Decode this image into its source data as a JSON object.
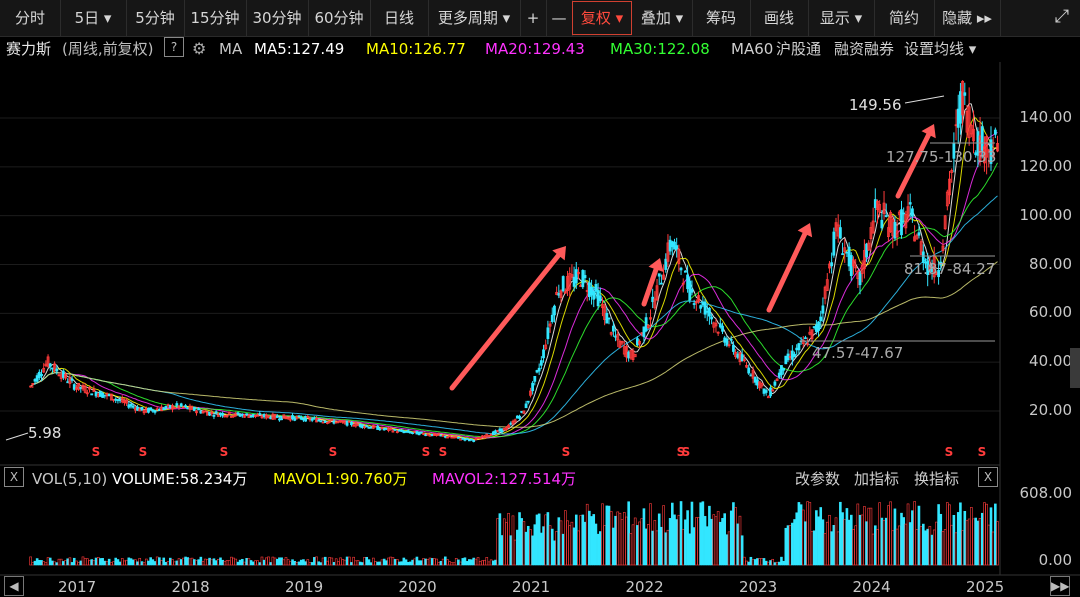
{
  "toolbar": {
    "items": [
      "分时",
      "5日 ▾",
      "5分钟",
      "15分钟",
      "30分钟",
      "60分钟",
      "日线",
      "更多周期 ▾",
      "+",
      "—",
      "复权 ▾",
      "叠加 ▾",
      "筹码",
      "画线",
      "显示 ▾",
      "简约",
      "隐藏 ▸▸"
    ],
    "active_index": 10,
    "expand_icon": "expand-icon"
  },
  "info": {
    "stock_name": "赛力斯",
    "period_note": "(周线,前复权)",
    "help": "?",
    "gear_icon": "gear-icon",
    "ma_label": "MA",
    "ma5": "MA5:127.49",
    "ma10": "MA10:126.77",
    "ma20": "MA20:129.43",
    "ma30": "MA30:122.08",
    "ma60": "MA60",
    "hsgt": "沪股通",
    "margin": "融资融券",
    "settings": "设置均线 ▾"
  },
  "vol": {
    "close_box": "X",
    "label": "VOL(5,10)",
    "volume": "VOLUME:58.234万",
    "mavol1": "MAVOL1:90.760万",
    "mavol2": "MAVOL2:127.514万",
    "change_params": "改参数",
    "add_indicator": "加指标",
    "switch_indicator": "换指标",
    "close_box2": "X"
  },
  "colors": {
    "up": "#ff3b3b",
    "down": "#33e6ff",
    "ma5": "#ffffff",
    "ma10": "#ffff00",
    "ma20": "#ff33ff",
    "ma30": "#33ff33",
    "ma60": "#33ccff",
    "arrow": "#ff5a5a",
    "annotation": "#c8c8c8"
  },
  "chart_data": {
    "type": "candlestick",
    "period": "weekly",
    "y_ticks": [
      "140.00",
      "120.00",
      "100.00",
      "80.00",
      "60.00",
      "40.00",
      "20.00"
    ],
    "ylim": [
      5,
      150
    ],
    "x_ticks": [
      "2017",
      "2018",
      "2019",
      "2020",
      "2021",
      "2022",
      "2023",
      "2024",
      "2025"
    ],
    "annotations": {
      "high": "149.56",
      "low": "5.98",
      "range1": "127.75-130.33",
      "range2": "81.87-84.27",
      "range3": "47.57-47.67"
    },
    "price_keypoints": [
      [
        2016.6,
        30
      ],
      [
        2016.75,
        40
      ],
      [
        2017.0,
        30
      ],
      [
        2017.3,
        26
      ],
      [
        2017.6,
        20
      ],
      [
        2017.9,
        22
      ],
      [
        2018.2,
        19
      ],
      [
        2018.6,
        18
      ],
      [
        2019.0,
        17
      ],
      [
        2019.4,
        15
      ],
      [
        2019.8,
        12
      ],
      [
        2020.2,
        10
      ],
      [
        2020.5,
        8
      ],
      [
        2020.8,
        13
      ],
      [
        2020.95,
        20
      ],
      [
        2021.1,
        40
      ],
      [
        2021.25,
        70
      ],
      [
        2021.45,
        75
      ],
      [
        2021.6,
        67
      ],
      [
        2021.75,
        50
      ],
      [
        2021.9,
        42
      ],
      [
        2022.05,
        58
      ],
      [
        2022.25,
        90
      ],
      [
        2022.4,
        70
      ],
      [
        2022.55,
        62
      ],
      [
        2022.75,
        48
      ],
      [
        2022.95,
        36
      ],
      [
        2023.1,
        26
      ],
      [
        2023.25,
        40
      ],
      [
        2023.4,
        47
      ],
      [
        2023.55,
        55
      ],
      [
        2023.7,
        95
      ],
      [
        2023.9,
        72
      ],
      [
        2024.05,
        103
      ],
      [
        2024.2,
        95
      ],
      [
        2024.35,
        100
      ],
      [
        2024.5,
        80
      ],
      [
        2024.6,
        78
      ],
      [
        2024.68,
        105
      ],
      [
        2024.8,
        149
      ],
      [
        2024.95,
        130
      ],
      [
        2025.1,
        128
      ]
    ],
    "volume_ylim": [
      0,
      608
    ],
    "volume_ticks": [
      "608.00",
      "0.00"
    ]
  }
}
